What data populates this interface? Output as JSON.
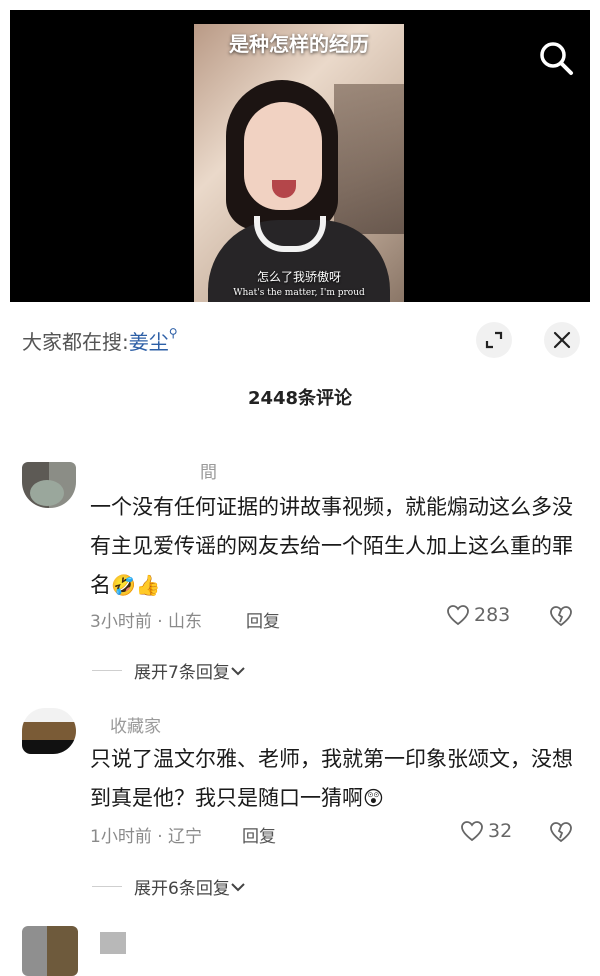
{
  "video": {
    "title": "是种怎样的经历",
    "subtitle_cn": "怎么了我骄傲呀",
    "subtitle_en": "What's the matter, I'm proud"
  },
  "search_bar": {
    "prefix": "大家都在搜:",
    "keyword": "姜尘"
  },
  "comments_header": {
    "count_label": "2448条评论"
  },
  "comments": [
    {
      "username": "間",
      "text": "一个没有任何证据的讲故事视频，就能煽动这么多没有主见爱传谣的网友去给一个陌生人加上这么重的罪名",
      "emoji": "🤣👍",
      "meta": "3小时前 · 山东",
      "reply_label": "回复",
      "likes": "283",
      "expand_label": "展开7条回复"
    },
    {
      "username": "收藏家",
      "text": "只说了温文尔雅、老师，我就第一印象张颂文，没想到真是他？我只是随口一猜啊",
      "emoji": "😲",
      "meta": "1小时前 · 辽宁",
      "reply_label": "回复",
      "likes": "32",
      "expand_label": "展开6条回复"
    }
  ],
  "icons": {
    "search": "search-icon",
    "expand": "expand-icon",
    "close": "close-icon",
    "heart": "heart-icon",
    "broken_heart": "dislike-icon",
    "chevron": "chevron-down-icon"
  },
  "colors": {
    "keyword": "#2d5fa6",
    "meta": "#8a8a8a"
  }
}
